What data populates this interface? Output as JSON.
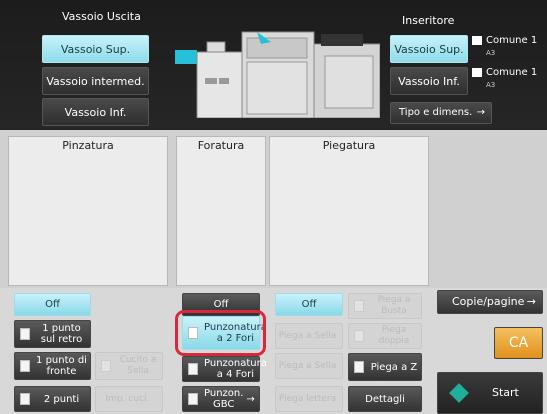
{
  "tray": {
    "title": "Vassoio Uscita",
    "options": [
      {
        "label": "Vassoio Sup.",
        "selected": true
      },
      {
        "label": "Vassoio intermed.",
        "selected": false
      },
      {
        "label": "Vassoio Inf.",
        "selected": false
      }
    ]
  },
  "inserter": {
    "title": "Inseritore",
    "options": [
      {
        "label": "Vassoio Sup.",
        "selected": true,
        "paper": "Comune 1",
        "size": "A3"
      },
      {
        "label": "Vassoio Inf.",
        "selected": false,
        "paper": "Comune 1",
        "size": "A3"
      }
    ],
    "tipo_label": "Tipo e dimens."
  },
  "pinzatura": {
    "title": "Pinzatura",
    "off": "Off",
    "p1": "1 punto sul retro",
    "p2": "1 punto di fronte",
    "p3": "2 punti",
    "cucito": "Cucito a Sella",
    "imp": "Imp. cuci."
  },
  "foratura": {
    "title": "Foratura",
    "off": "Off",
    "f2": "Punzonatura a 2 Fori",
    "f4": "Punzonatura a 4 Fori",
    "gbc": "Punzon. GBC"
  },
  "piegatura": {
    "title": "Piegatura",
    "off": "Off",
    "a": "Piega a Sella",
    "b": "Piega a Busta",
    "c": "Piega a Sella",
    "d": "Piega doppia",
    "e": "Piega a Sella",
    "z": "Piega a Z",
    "f": "Piega lettera",
    "dettagli": "Dettagli"
  },
  "right": {
    "copie": "Copie/pagine",
    "ca": "CA",
    "start": "Start"
  },
  "colors": {
    "accent": "#8fdbea",
    "highlight": "#d8283c",
    "ca": "#e89a1c",
    "start": "#1fae9a"
  }
}
